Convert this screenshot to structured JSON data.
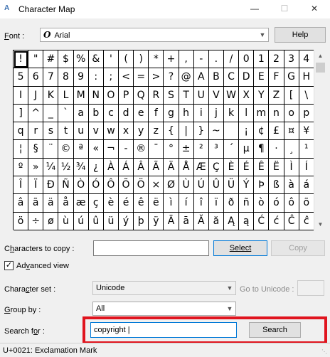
{
  "window": {
    "title": "Character Map",
    "minimize": "—",
    "maximize": "☐",
    "close": "✕"
  },
  "font": {
    "label_underlined": "F",
    "label_rest": "ont :",
    "icon": "O",
    "value": "Arial",
    "help_label": "Help"
  },
  "grid": {
    "rows": [
      [
        "!",
        "\"",
        "#",
        "$",
        "%",
        "&",
        "'",
        "(",
        ")",
        "*",
        "+",
        ",",
        "-",
        ".",
        "/",
        "0",
        "1",
        "2",
        "3",
        "4"
      ],
      [
        "5",
        "6",
        "7",
        "8",
        "9",
        ":",
        ";",
        "<",
        "=",
        ">",
        "?",
        "@",
        "A",
        "B",
        "C",
        "D",
        "E",
        "F",
        "G",
        "H"
      ],
      [
        "I",
        "J",
        "K",
        "L",
        "M",
        "N",
        "O",
        "P",
        "Q",
        "R",
        "S",
        "T",
        "U",
        "V",
        "W",
        "X",
        "Y",
        "Z",
        "[",
        "\\"
      ],
      [
        "]",
        "^",
        "_",
        "`",
        "a",
        "b",
        "c",
        "d",
        "e",
        "f",
        "g",
        "h",
        "i",
        "j",
        "k",
        "l",
        "m",
        "n",
        "o",
        "p"
      ],
      [
        "q",
        "r",
        "s",
        "t",
        "u",
        "v",
        "w",
        "x",
        "y",
        "z",
        "{",
        "|",
        "}",
        "~",
        " ",
        "¡",
        "¢",
        "£",
        "¤",
        "¥"
      ],
      [
        "¦",
        "§",
        "¨",
        "©",
        "ª",
        "«",
        "¬",
        "-",
        "®",
        "¯",
        "°",
        "±",
        "²",
        "³",
        "´",
        "µ",
        "¶",
        "·",
        "¸",
        "¹"
      ],
      [
        "º",
        "»",
        "¼",
        "½",
        "¾",
        "¿",
        "À",
        "Á",
        "Â",
        "Ã",
        "Ä",
        "Å",
        "Æ",
        "Ç",
        "È",
        "É",
        "Ê",
        "Ë",
        "Ì",
        "Í"
      ],
      [
        "Î",
        "Ï",
        "Ð",
        "Ñ",
        "Ò",
        "Ó",
        "Ô",
        "Õ",
        "Ö",
        "×",
        "Ø",
        "Ù",
        "Ú",
        "Û",
        "Ü",
        "Ý",
        "Þ",
        "ß",
        "à",
        "á"
      ],
      [
        "â",
        "ã",
        "ä",
        "å",
        "æ",
        "ç",
        "è",
        "é",
        "ê",
        "ë",
        "ì",
        "í",
        "î",
        "ï",
        "ð",
        "ñ",
        "ò",
        "ó",
        "ô",
        "õ"
      ],
      [
        "ö",
        "÷",
        "ø",
        "ù",
        "ú",
        "û",
        "ü",
        "ý",
        "þ",
        "ÿ",
        "Ā",
        "ā",
        "Ă",
        "ă",
        "Ą",
        "ą",
        "Ć",
        "ć",
        "Ĉ",
        "ĉ"
      ]
    ],
    "selected_index": 0
  },
  "copy": {
    "label_pre": "C",
    "label_underlined": "h",
    "label_rest": "aracters to copy :",
    "value": "",
    "select_label": "Select",
    "copy_label": "Copy"
  },
  "advanced": {
    "checked": "✓",
    "label_pre": "Ad",
    "label_underlined": "v",
    "label_rest": "anced view"
  },
  "charset": {
    "label_pre": "Chara",
    "label_underlined": "c",
    "label_rest": "ter set :",
    "value": "Unicode",
    "goto_label": "Go to Unicode :",
    "goto_value": ""
  },
  "groupby": {
    "label_underlined": "G",
    "label_rest": "roup by :",
    "value": "All"
  },
  "search": {
    "label_pre": "Search f",
    "label_underlined": "o",
    "label_rest": "r :",
    "value": "copyright |",
    "button_label": "Search"
  },
  "status": {
    "text": "U+0021: Exclamation Mark"
  },
  "colors": {
    "highlight": "#e0141e",
    "focus_border": "#0078d7"
  }
}
